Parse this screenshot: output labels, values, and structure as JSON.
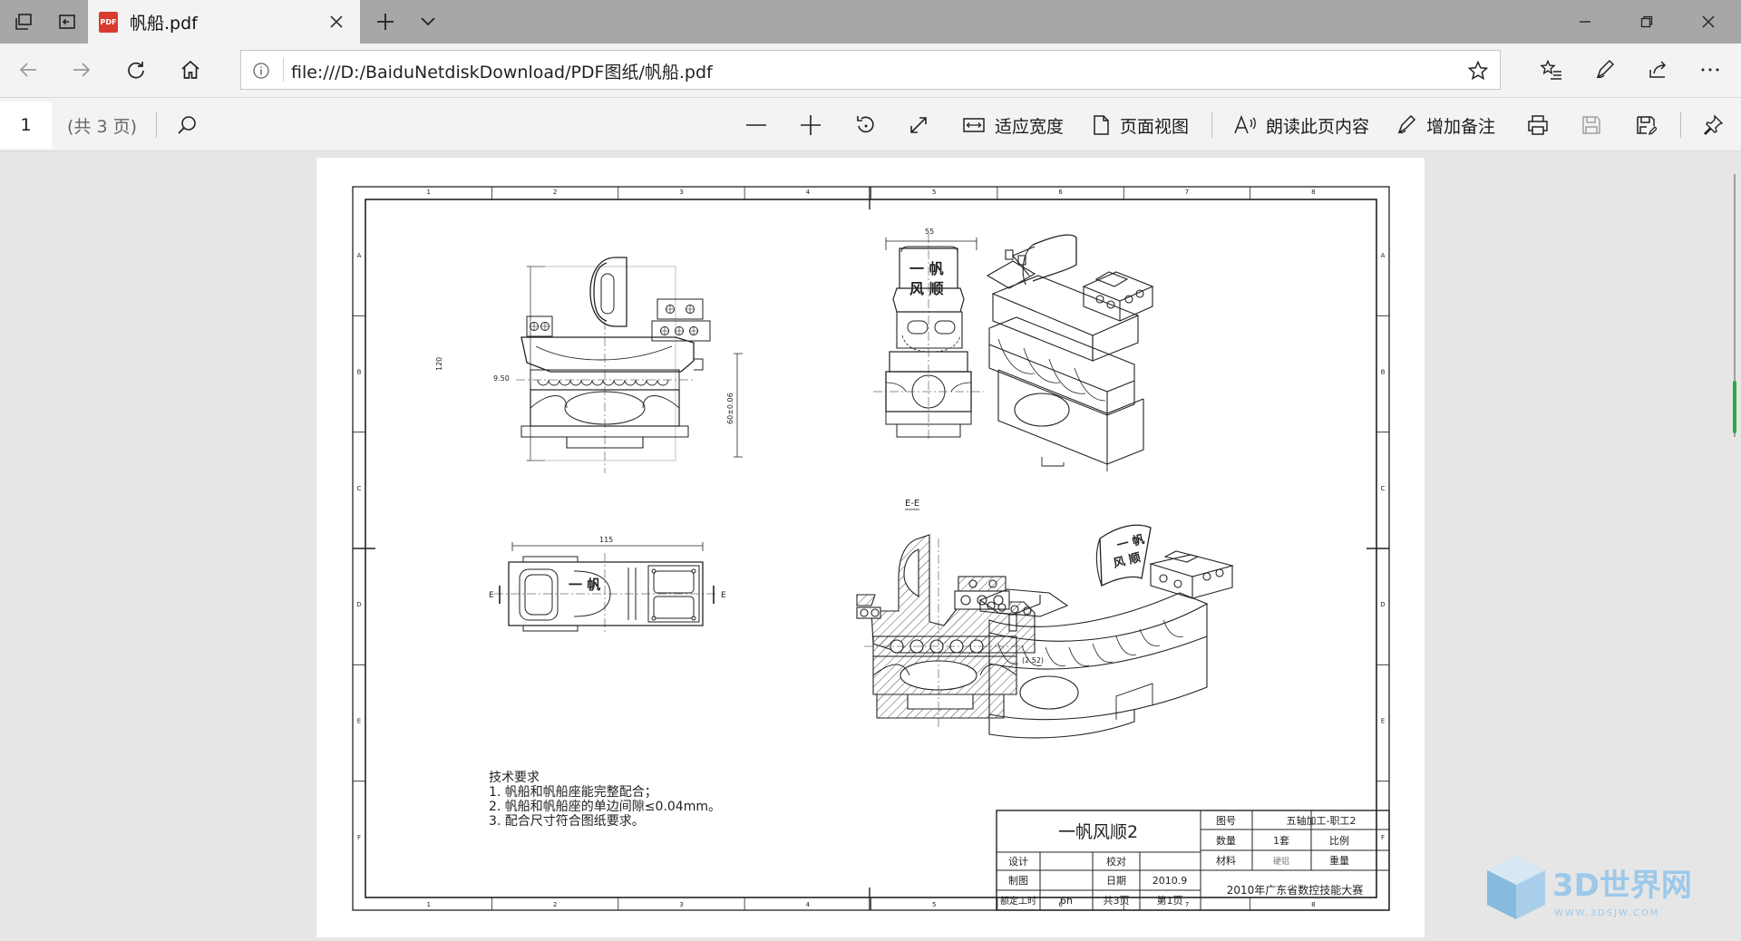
{
  "browser": {
    "tab": {
      "icon_text": "PDF",
      "title": "帆船.pdf"
    },
    "address": {
      "url": "file:///D:/BaiduNetdiskDownload/PDF图纸/帆船.pdf"
    }
  },
  "pdf_toolbar": {
    "page_number": "1",
    "page_total": "(共 3 页)",
    "fit_width": "适应宽度",
    "page_view": "页面视图",
    "read_aloud": "朗读此页内容",
    "add_notes": "增加备注"
  },
  "drawing": {
    "columns": [
      "1",
      "2",
      "3",
      "4",
      "5",
      "6",
      "7",
      "8"
    ],
    "rows": [
      "A",
      "B",
      "C",
      "D",
      "E",
      "F"
    ],
    "dims": {
      "width_top": "55",
      "height_left": "120",
      "offset_left": "9.50",
      "height_right": "60±0.06",
      "width_bottom": "115",
      "gap": "(2.52)"
    },
    "section_label": "E-E",
    "section_mark": "E",
    "boat_text_1": "一 帆",
    "boat_text_2": "风 顺",
    "notes_title": "技术要求",
    "notes": [
      "1.   帆船和帆船座能完整配合；",
      "2.   帆船和帆船座的单边间隙≤0.04mm。",
      "3.   配合尺寸符合图纸要求。"
    ],
    "title_block": {
      "part_name": "一帆风顺2",
      "drawing_no_label": "图号",
      "drawing_no": "五轴加工-职工2",
      "qty_label": "数量",
      "qty": "1套",
      "scale_label": "比例",
      "material_label": "材料",
      "material": "硬铝",
      "weight_label": "重量",
      "design_label": "设计",
      "check_label": "校对",
      "draw_label": "制图",
      "date_label": "日期",
      "date": "2010.9",
      "hours_label": "额定工时",
      "hours": "6h",
      "total_pages": "共3页",
      "page": "第1页",
      "competition": "2010年广东省数控技能大赛"
    }
  },
  "watermark": {
    "text": "3D世界网",
    "sub": "WWW.3DSJW.COM"
  },
  "colors": {
    "tabbar": "#a7a7a7",
    "chrome": "#f3f3f3",
    "scroll_accent": "#2ea84a",
    "pdf_icon": "#d93b2f",
    "watermark": "#5aa8d8"
  }
}
